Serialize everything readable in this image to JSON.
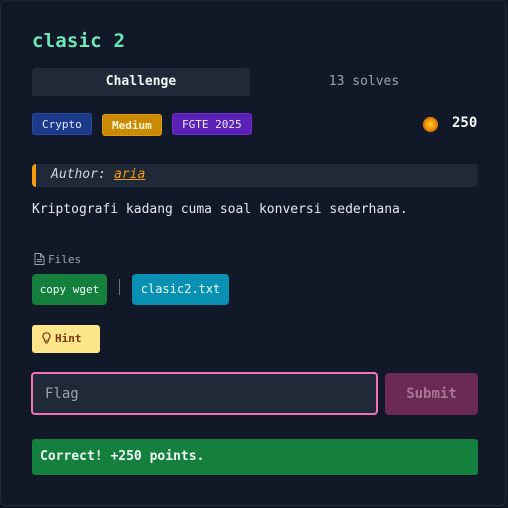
{
  "challenge": {
    "title": "clasic 2",
    "tabs": [
      {
        "label": "Challenge",
        "active": true
      },
      {
        "label": "13 solves",
        "active": false
      }
    ],
    "badges": {
      "category": "Crypto",
      "difficulty": "Medium",
      "event": "FGTE 2025"
    },
    "points": "250",
    "author": {
      "label": "Author:",
      "name": "aria"
    },
    "description": "Kriptografi kadang cuma soal konversi sederhana.",
    "files": {
      "label": "Files",
      "copy_wget_label": "copy wget",
      "file_name": "clasic2.txt"
    },
    "hint_label": "Hint",
    "flag_input": {
      "placeholder": "Flag",
      "value": ""
    },
    "submit_label": "Submit",
    "result_message": "Correct! +250 points."
  },
  "colors": {
    "background": "#111827",
    "title": "#6ee7b7",
    "accent": "#f59e0b",
    "success": "#15803d",
    "input_border": "#f472b6",
    "submit": "#6b2a55"
  },
  "icons": {
    "coin": "coin-icon",
    "files": "file-icon",
    "hint": "lightbulb-icon"
  }
}
